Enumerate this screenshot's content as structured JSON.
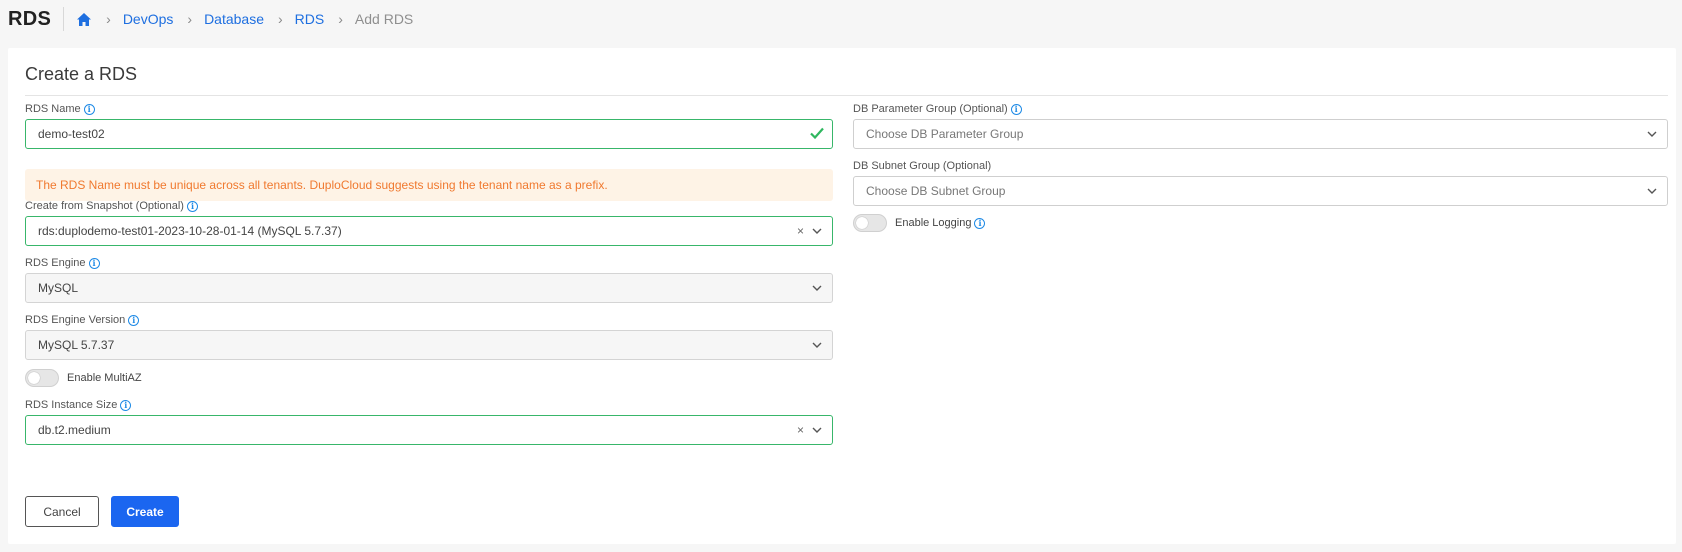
{
  "header": {
    "app_title": "RDS",
    "breadcrumbs": [
      {
        "label": "DevOps"
      },
      {
        "label": "Database"
      },
      {
        "label": "RDS"
      }
    ],
    "current": "Add RDS"
  },
  "form": {
    "title": "Create a RDS",
    "rds_name": {
      "label": "RDS Name",
      "value": "demo-test02"
    },
    "notice": "The RDS Name must be unique across all tenants. DuploCloud suggests using the tenant name as a prefix.",
    "snapshot": {
      "label": "Create from Snapshot (Optional)",
      "value": "rds:duplodemo-test01-2023-10-28-01-14 (MySQL 5.7.37)"
    },
    "engine": {
      "label": "RDS Engine",
      "value": "MySQL"
    },
    "engine_version": {
      "label": "RDS Engine Version",
      "value": "MySQL 5.7.37"
    },
    "multiaz": {
      "label": "Enable MultiAZ",
      "enabled": false
    },
    "instance_size": {
      "label": "RDS Instance Size",
      "value": "db.t2.medium"
    },
    "param_group": {
      "label": "DB Parameter Group (Optional)",
      "placeholder": "Choose DB Parameter Group"
    },
    "subnet_group": {
      "label": "DB Subnet Group (Optional)",
      "placeholder": "Choose DB Subnet Group"
    },
    "logging": {
      "label": "Enable Logging",
      "enabled": false
    },
    "cancel_label": "Cancel",
    "create_label": "Create"
  },
  "colors": {
    "primary": "#1b66f0",
    "link": "#1e6fe0",
    "valid_border": "#38b66a",
    "notice_bg": "#fef3e6",
    "notice_text": "#f0792f"
  },
  "icons": {
    "home": "home-icon",
    "info": "info-icon",
    "check": "check-icon",
    "chevron": "chevron-down-icon",
    "clear": "clear-icon"
  }
}
